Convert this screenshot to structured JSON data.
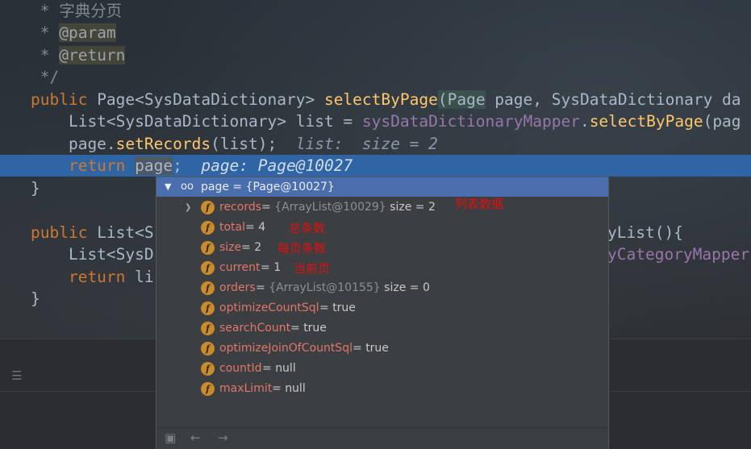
{
  "code": {
    "comment1": " * 字典分页",
    "comment2_prefix": " * ",
    "comment2_tag": "@param",
    "comment3_prefix": " * ",
    "comment3_tag": "@return",
    "comment4": " */",
    "l5_kw": "public ",
    "l5_a": "Page<SysDataDictionary> ",
    "l5_method": "selectByPage",
    "l5_paren": "(",
    "l5_ptype": "Page",
    "l5_b": " page, SysDataDictionary da",
    "l6_a": "    List<SysDataDictionary> list = ",
    "l6_field": "sysDataDictionaryMapper",
    "l6_b": ".",
    "l6_method": "selectByPage",
    "l6_c": "(pag",
    "l7_a": "    page.",
    "l7_method": "setRecords",
    "l7_b": "(list);",
    "l7_hint": "  list:  size = 2",
    "l8_kw": "    return ",
    "l8_word": "page",
    "l8_b": ";",
    "l8_hint": "  page: Page@10027",
    "l9": "}",
    "l11_kw": "public ",
    "l11_a": "List<S",
    "l11_tail": "yList(){",
    "l12_a": "    List<SysD",
    "l12_tail": "yCategoryMapper.",
    "l13_kw": "    return ",
    "l13_a": "li",
    "l14": "}"
  },
  "popup": {
    "header": "page = {Page@10027}",
    "items": [
      {
        "name": "records",
        "eq": " = ",
        "value_gray": "{ArrayList@10029}",
        "value": " size = 2",
        "expandable": true
      },
      {
        "name": "total",
        "eq": " = ",
        "value_gray": "",
        "value": "4",
        "expandable": false
      },
      {
        "name": "size",
        "eq": " = ",
        "value_gray": "",
        "value": "2",
        "expandable": false
      },
      {
        "name": "current",
        "eq": " = ",
        "value_gray": "",
        "value": "1",
        "expandable": false
      },
      {
        "name": "orders",
        "eq": " = ",
        "value_gray": "{ArrayList@10155}",
        "value": " size = 0",
        "expandable": false
      },
      {
        "name": "optimizeCountSql",
        "eq": " = ",
        "value_gray": "",
        "value": "true",
        "expandable": false
      },
      {
        "name": "searchCount",
        "eq": " = ",
        "value_gray": "",
        "value": "true",
        "expandable": false
      },
      {
        "name": "optimizeJoinOfCountSql",
        "eq": " = ",
        "value_gray": "",
        "value": "true",
        "expandable": false
      },
      {
        "name": "countId",
        "eq": " = ",
        "value_gray": "",
        "value": "null",
        "expandable": false
      },
      {
        "name": "maxLimit",
        "eq": " = ",
        "value_gray": "",
        "value": "null",
        "expandable": false
      }
    ],
    "field_icon": "f",
    "annotations": {
      "records": "列表数据",
      "total": "总条数",
      "size": "每页条数",
      "current": "当前页"
    }
  },
  "colors": {
    "highlight_line": "#2f65a5",
    "popup_header": "#4b6eaf",
    "annotation": "#e01010",
    "field_name": "#e0766c"
  }
}
